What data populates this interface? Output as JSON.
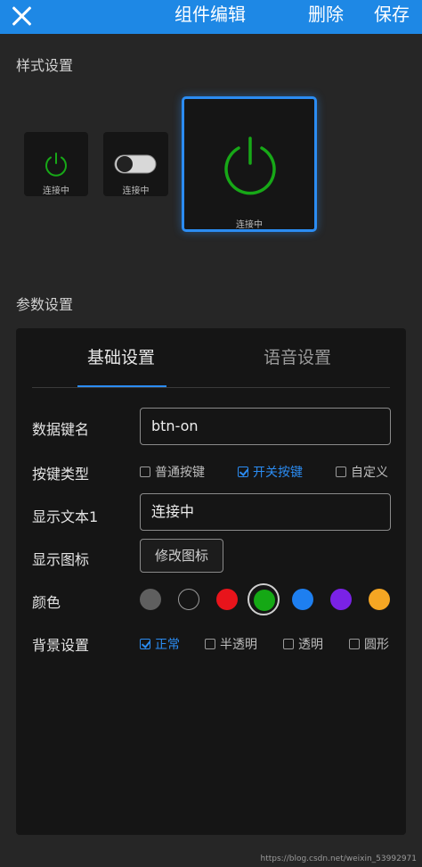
{
  "header": {
    "title": "组件编辑",
    "delete_label": "删除",
    "save_label": "保存"
  },
  "style_section": {
    "title": "样式设置",
    "cards": [
      {
        "icon": "power-icon",
        "label": "连接中"
      },
      {
        "icon": "toggle-switch-icon",
        "label": "连接中"
      },
      {
        "icon": "power-icon",
        "label": "连接中"
      }
    ]
  },
  "param_section": {
    "title": "参数设置",
    "tabs": [
      "基础设置",
      "语音设置"
    ],
    "data_key": {
      "label": "数据键名",
      "value": "btn-on"
    },
    "button_type": {
      "label": "按键类型",
      "options": [
        "普通按键",
        "开关按键",
        "自定义"
      ],
      "selected": "开关按键"
    },
    "display_text": {
      "label": "显示文本1",
      "value": "连接中"
    },
    "display_icon": {
      "label": "显示图标",
      "button": "修改图标"
    },
    "color": {
      "label": "颜色",
      "swatches": [
        "#5f5f5f",
        "#151515",
        "#e8141b",
        "#15a815",
        "#1e7ff0",
        "#7a22e6",
        "#f5a623"
      ],
      "selected_color": "#15a815"
    },
    "background": {
      "label": "背景设置",
      "options": [
        "正常",
        "半透明",
        "透明",
        "圆形"
      ],
      "selected": "正常"
    }
  },
  "colors": {
    "accent": "#2b8cf2",
    "power_green": "#17a817"
  },
  "watermark": "https://blog.csdn.net/weixin_53992971"
}
